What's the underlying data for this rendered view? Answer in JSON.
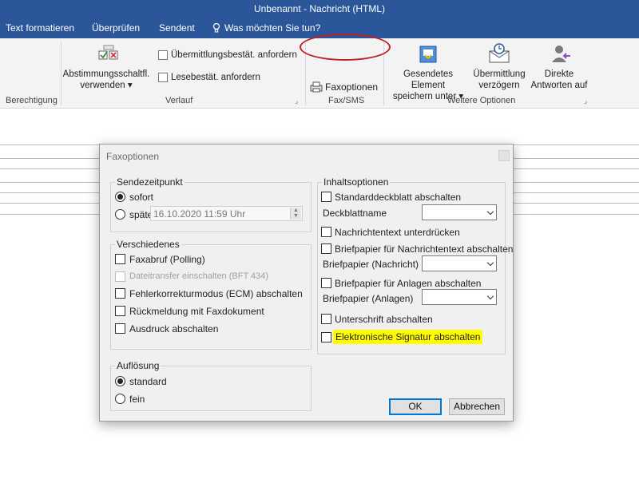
{
  "window": {
    "title": "Unbenannt - Nachricht (HTML)"
  },
  "menu": {
    "items": [
      "Text formatieren",
      "Überprüfen",
      "Sendent"
    ],
    "tell_me": "Was möchten Sie tun?"
  },
  "ribbon": {
    "groups": {
      "berechtigung": "Berechtigung",
      "verlauf": "Verlauf",
      "faxsms": "Fax/SMS",
      "weitere": "Weitere Optionen"
    },
    "voting_button_line1": "Abstimmungsschaltfl.",
    "voting_button_line2": "verwenden ▾",
    "delivery_receipt": "Übermittlungsbestät. anfordern",
    "read_receipt": "Lesebestät. anfordern",
    "fax_options": "Faxoptionen",
    "saved_item_line1": "Gesendetes Element",
    "saved_item_line2": "speichern unter ▾",
    "delay_line1": "Übermittlung",
    "delay_line2": "verzögern",
    "direct_line1": "Direkte",
    "direct_line2": "Antworten auf"
  },
  "dialog": {
    "title": "Faxoptionen",
    "send_time": {
      "label": "Sendezeitpunkt",
      "option_now": "sofort",
      "option_later": "später",
      "later_value": "16.10.2020 11:59 Uhr"
    },
    "misc": {
      "label": "Verschiedenes",
      "items": [
        {
          "text": "Faxabruf (Polling)",
          "disabled": false
        },
        {
          "text": "Dateitransfer einschalten (BFT 434)",
          "disabled": true
        },
        {
          "text": "Fehlerkorrekturmodus (ECM) abschalten",
          "disabled": false
        },
        {
          "text": "Rückmeldung mit Faxdokument",
          "disabled": false
        },
        {
          "text": "Ausdruck abschalten",
          "disabled": false
        }
      ]
    },
    "resolution": {
      "label": "Auflösung",
      "option_standard": "standard",
      "option_fine": "fein"
    },
    "content": {
      "label": "Inhaltsoptionen",
      "disable_cover": "Standarddeckblatt abschalten",
      "cover_name": "Deckblattname",
      "suppress_text": "Nachrichtentext unterdrücken",
      "disable_letterhead_text": "Briefpapier für Nachrichtentext abschalten",
      "letterhead_message": "Briefpapier (Nachricht)",
      "disable_letterhead_attach": "Briefpapier für Anlagen abschalten",
      "letterhead_attachments": "Briefpapier (Anlagen)",
      "disable_signature": "Unterschrift abschalten",
      "disable_esignature": "Elektronische Signatur abschalten"
    },
    "ok": "OK",
    "cancel": "Abbrechen"
  },
  "colors": {
    "ribbon_blue": "#2b579a",
    "highlight": "#fffb00",
    "annotation_red": "#c0202a"
  }
}
